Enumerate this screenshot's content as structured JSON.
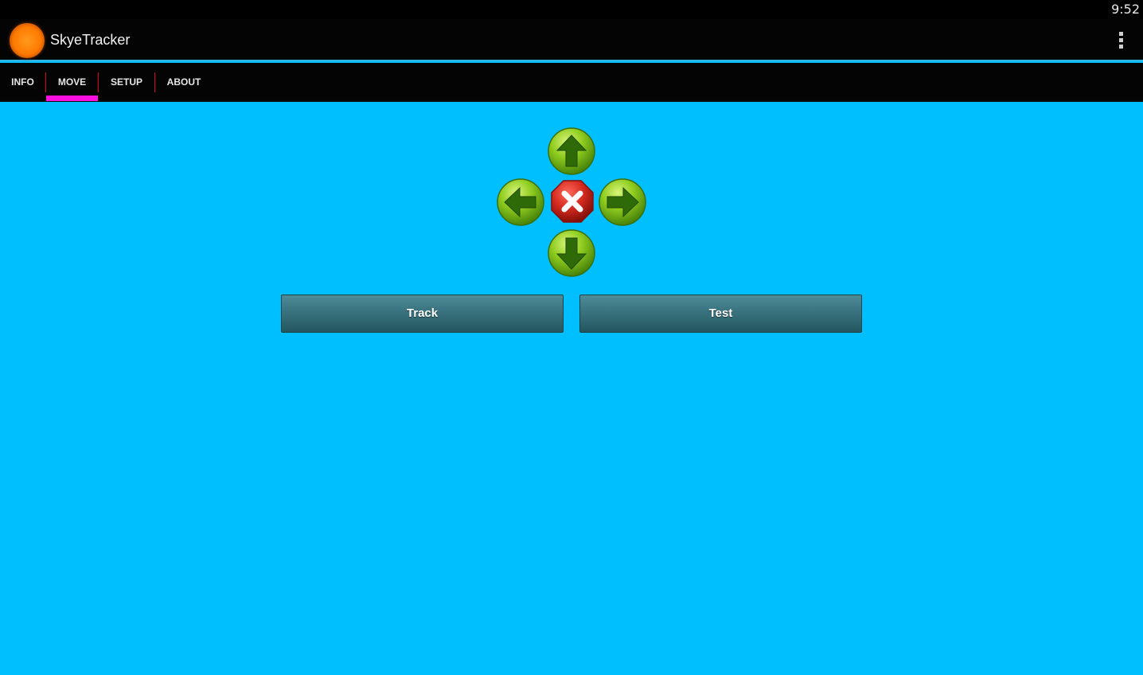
{
  "status_bar": {
    "time": "9:52"
  },
  "action_bar": {
    "title": "SkyeTracker",
    "icon": "app-orange-circle-icon",
    "overflow": "overflow-menu-icon"
  },
  "tabs": [
    {
      "label": "INFO",
      "selected": false
    },
    {
      "label": "MOVE",
      "selected": true
    },
    {
      "label": "SETUP",
      "selected": false
    },
    {
      "label": "ABOUT",
      "selected": false
    }
  ],
  "colors": {
    "background": "#00bfff",
    "action_bar_underline": "#33b5e5",
    "tab_indicator": "#ff10e0",
    "tab_divider": "#d8002a",
    "arrow_button": "#7cc41a",
    "stop_button": "#d42a1f"
  },
  "dpad": {
    "up": "arrow-up-icon",
    "left": "arrow-left-icon",
    "stop": "stop-icon",
    "right": "arrow-right-icon",
    "down": "arrow-down-icon"
  },
  "buttons": {
    "track_label": "Track",
    "test_label": "Test"
  }
}
